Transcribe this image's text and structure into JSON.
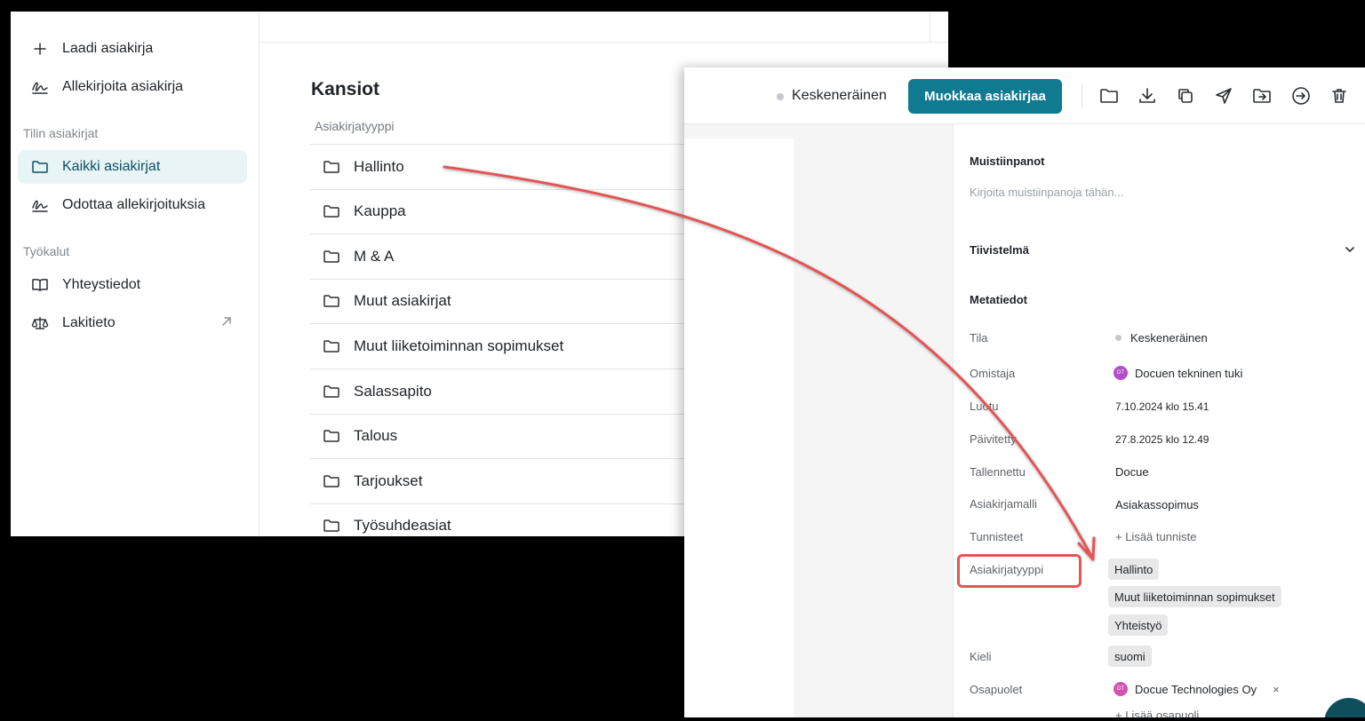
{
  "sidebar": {
    "actions": [
      {
        "label": "Laadi asiakirja",
        "icon": "plus-icon"
      },
      {
        "label": "Allekirjoita asiakirja",
        "icon": "signature-icon"
      }
    ],
    "section_documents": "Tilin asiakirjat",
    "documents": [
      {
        "label": "Kaikki asiakirjat",
        "icon": "folder-icon",
        "active": true
      },
      {
        "label": "Odottaa allekirjoituksia",
        "icon": "signature-icon"
      }
    ],
    "section_tools": "Työkalut",
    "tools": [
      {
        "label": "Yhteystiedot",
        "icon": "book-icon"
      },
      {
        "label": "Lakitieto",
        "icon": "scales-icon",
        "external_icon": "arrow-up-right-icon"
      }
    ]
  },
  "folders": {
    "title": "Kansiot",
    "column_header": "Asiakirjatyyppi",
    "items": [
      "Hallinto",
      "Kauppa",
      "M & A",
      "Muut asiakirjat",
      "Muut liiketoiminnan sopimukset",
      "Salassapito",
      "Talous",
      "Tarjoukset",
      "Työsuhdeasiat"
    ]
  },
  "document_panel": {
    "status": "Keskeneräinen",
    "edit_button": "Muokkaa asiakirjaa",
    "toolbar_icons": [
      "folder-icon",
      "download-icon",
      "copy-icon",
      "send-icon",
      "move-folder-icon",
      "export-icon",
      "trash-icon"
    ],
    "notes": {
      "title": "Muistiinpanot",
      "placeholder": "Kirjoita muistiinpanoja tähän..."
    },
    "summary": {
      "title": "Tiivistelmä"
    },
    "metadata": {
      "title": "Metatiedot",
      "tila_label": "Tila",
      "tila_value": "Keskeneräinen",
      "owner_label": "Omistaja",
      "owner_initials": "DT",
      "owner_value": "Docuen tekninen tuki",
      "created_label": "Luotu",
      "created_value": "7.10.2024 klo 15.41",
      "updated_label": "Päivitetty",
      "updated_value": "27.8.2025 klo 12.49",
      "saved_label": "Tallennettu",
      "saved_value": "Docue",
      "template_label": "Asiakirjamalli",
      "template_value": "Asiakassopimus",
      "tags_label": "Tunnisteet",
      "tags_add": "+ Lisää tunniste",
      "doctype_label": "Asiakirjatyyppi",
      "doctypes": [
        "Hallinto",
        "Muut liiketoiminnan sopimukset",
        "Yhteistyö"
      ],
      "language_label": "Kieli",
      "language_value": "suomi",
      "parties_label": "Osapuolet",
      "party_initials": "DT",
      "party_value": "Docue Technologies Oy",
      "party_remove": "×",
      "parties_add": "+ Lisää osapuoli"
    }
  },
  "colors": {
    "accent": "#0f7a90",
    "annotation": "#e25555",
    "active_bg": "#e8f4f6"
  }
}
